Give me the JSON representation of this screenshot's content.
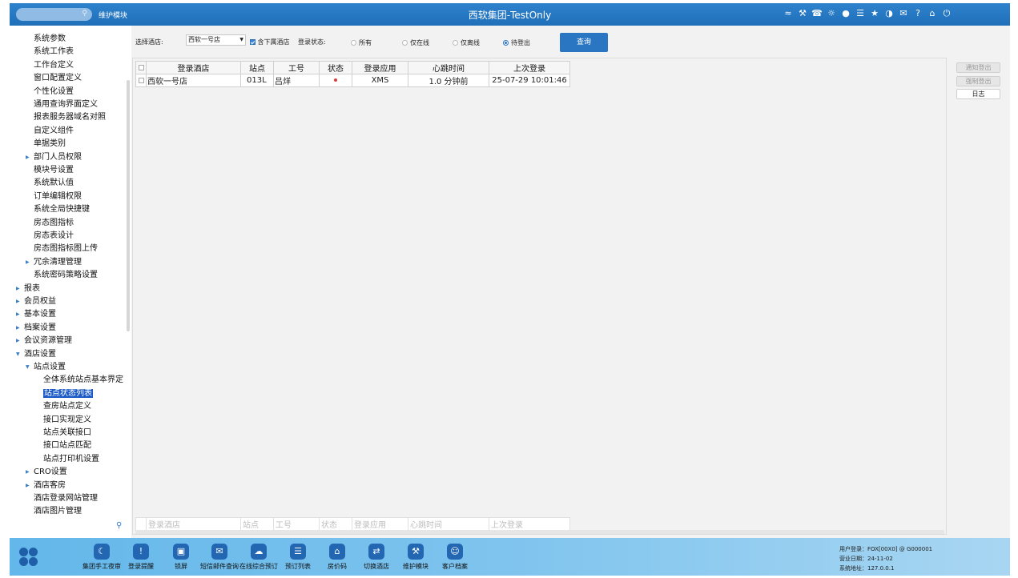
{
  "header": {
    "module": "维护模块",
    "title": "西软集团-TestOnly",
    "search_placeholder": "",
    "icons": [
      "wifi-icon",
      "tools-icon",
      "phone-icon",
      "chat-icon",
      "palette-icon",
      "menu-icon",
      "star-icon",
      "moon-icon",
      "mail-icon",
      "help-icon",
      "home-icon",
      "power-icon"
    ]
  },
  "sidebar": {
    "items": [
      {
        "label": "系统参数",
        "level": 2,
        "arrow": false
      },
      {
        "label": "系统工作表",
        "level": 2,
        "arrow": false
      },
      {
        "label": "工作台定义",
        "level": 2,
        "arrow": false
      },
      {
        "label": "窗口配置定义",
        "level": 2,
        "arrow": false
      },
      {
        "label": "个性化设置",
        "level": 2,
        "arrow": false
      },
      {
        "label": "通用查询界面定义",
        "level": 2,
        "arrow": false
      },
      {
        "label": "报表服务器域名对照",
        "level": 2,
        "arrow": false
      },
      {
        "label": "自定义组件",
        "level": 2,
        "arrow": false
      },
      {
        "label": "单据类别",
        "level": 2,
        "arrow": false
      },
      {
        "label": "部门人员权限",
        "level": 2,
        "arrow": true
      },
      {
        "label": "模块号设置",
        "level": 2,
        "arrow": false
      },
      {
        "label": "系统默认值",
        "level": 2,
        "arrow": false
      },
      {
        "label": "订单编辑权限",
        "level": 2,
        "arrow": false
      },
      {
        "label": "系统全局快捷键",
        "level": 2,
        "arrow": false
      },
      {
        "label": "房态图指标",
        "level": 2,
        "arrow": false
      },
      {
        "label": "房态表设计",
        "level": 2,
        "arrow": false
      },
      {
        "label": "房态图指标图上传",
        "level": 2,
        "arrow": false
      },
      {
        "label": "冗余清理管理",
        "level": 2,
        "arrow": true
      },
      {
        "label": "系统密码策略设置",
        "level": 2,
        "arrow": false
      },
      {
        "label": "报表",
        "level": 1,
        "arrow": true
      },
      {
        "label": "会员权益",
        "level": 1,
        "arrow": true
      },
      {
        "label": "基本设置",
        "level": 1,
        "arrow": true
      },
      {
        "label": "档案设置",
        "level": 1,
        "arrow": true
      },
      {
        "label": "会议资源管理",
        "level": 1,
        "arrow": true
      },
      {
        "label": "酒店设置",
        "level": 1,
        "arrow": true,
        "open": true
      },
      {
        "label": "站点设置",
        "level": 2,
        "arrow": true,
        "open": true
      },
      {
        "label": "全体系统站点基本界定",
        "level": 3,
        "arrow": false
      },
      {
        "label": "站点状态列表",
        "level": 3,
        "arrow": false,
        "selected": true
      },
      {
        "label": "查房站点定义",
        "level": 3,
        "arrow": false
      },
      {
        "label": "接口实现定义",
        "level": 3,
        "arrow": false
      },
      {
        "label": "站点关联接口",
        "level": 3,
        "arrow": false
      },
      {
        "label": "接口站点匹配",
        "level": 3,
        "arrow": false
      },
      {
        "label": "站点打印机设置",
        "level": 3,
        "arrow": false
      },
      {
        "label": "CRO设置",
        "level": 2,
        "arrow": true
      },
      {
        "label": "酒店客房",
        "level": 2,
        "arrow": true
      },
      {
        "label": "酒店登录网站管理",
        "level": 2,
        "arrow": false
      },
      {
        "label": "酒店图片管理",
        "level": 2,
        "arrow": false
      }
    ]
  },
  "filters": {
    "hotel_label": "选择酒店:",
    "hotel_value": "西软一号店",
    "include_sub_label": "含下属酒店",
    "include_sub_checked": true,
    "login_status_label": "登录状态:",
    "radio_options": [
      "所有",
      "仅在线",
      "仅离线",
      "待登出"
    ],
    "radio_selected": 3,
    "query_label": "查询"
  },
  "table": {
    "columns": [
      "登录酒店",
      "站点",
      "工号",
      "状态",
      "登录应用",
      "心跳时间",
      "上次登录"
    ],
    "rows": [
      {
        "hotel": "西软一号店",
        "station": "013L",
        "staff": "吕烊",
        "status": "offline-red",
        "app": "XMS",
        "heartbeat": "1.0 分钟前",
        "last_login": "25-07-29 10:01:46"
      }
    ]
  },
  "right_buttons": {
    "notify": "通知登出",
    "force": "强制登出",
    "log": "日志"
  },
  "dock": {
    "items": [
      {
        "label": "集团手工夜审",
        "icon": "moon-icon"
      },
      {
        "label": "登录提醒",
        "icon": "alert-icon"
      },
      {
        "label": "锁屏",
        "icon": "lock-icon"
      },
      {
        "label": "短信邮件查询",
        "icon": "mail-icon"
      },
      {
        "label": "在线综合预订",
        "icon": "cloud-icon"
      },
      {
        "label": "预订列表",
        "icon": "list-icon"
      },
      {
        "label": "房价码",
        "icon": "house-icon"
      },
      {
        "label": "切换酒店",
        "icon": "switch-icon"
      },
      {
        "label": "维护模块",
        "icon": "wrench-icon"
      },
      {
        "label": "客户档案",
        "icon": "profile-icon"
      }
    ]
  },
  "user_info": {
    "user": "用户登录：FOX[00X0] @ G000001",
    "business_date": "营业日期：24-11-02",
    "system_address": "系统地址：127.0.0.1"
  },
  "colors": {
    "topbar": "#2a78c4",
    "selected": "#1d5cc7",
    "accent": "#2a76c2",
    "status_red": "#e03a3a"
  }
}
